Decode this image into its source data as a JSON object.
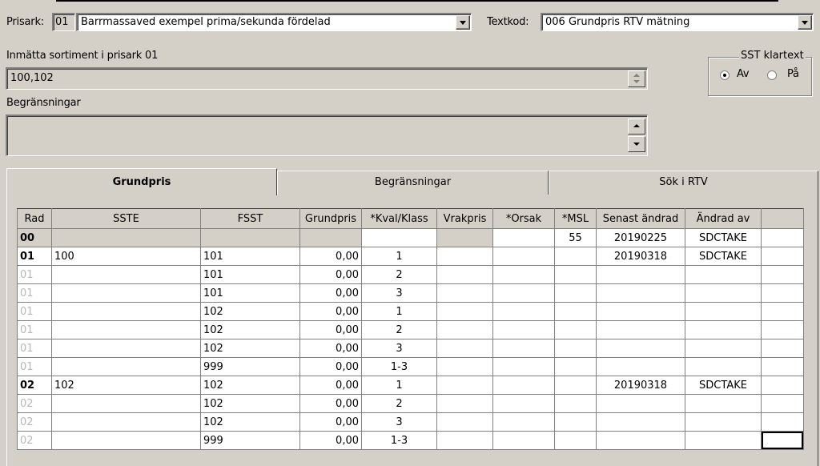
{
  "header": {
    "prisark_label": "Prisark:",
    "prisark_code": "01",
    "prisark_value": "Barrmassaved exempel prima/sekunda fördelad",
    "textkod_label": "Textkod:",
    "textkod_value": "006 Grundpris RTV mätning"
  },
  "sortiment": {
    "label": "Inmätta sortiment i prisark 01",
    "value": "100,102"
  },
  "restrictions": {
    "label": "Begränsningar",
    "value": ""
  },
  "sst_klartext": {
    "title": "SST klartext",
    "options": [
      {
        "label": "Av",
        "selected": true
      },
      {
        "label": "På",
        "selected": false
      }
    ]
  },
  "tabs": [
    {
      "label": "Grundpris",
      "active": true
    },
    {
      "label": "Begränsningar",
      "active": false
    },
    {
      "label": "Sök i RTV",
      "active": false
    }
  ],
  "grid": {
    "columns": [
      "Rad",
      "SSTE",
      "FSST",
      "Grundpris",
      "*Kval/Klass",
      "Vrakpris",
      "*Orsak",
      "*MSL",
      "Senast ändrad",
      "Ändrad av",
      ""
    ],
    "rows": [
      {
        "rad": "00",
        "sste": "",
        "fsst": "",
        "grundpris": "",
        "kval": "",
        "vrakpris": "",
        "orsak": "",
        "msl": "55",
        "senast": "20190225",
        "andrad_av": "SDCTAKE",
        "style": "header"
      },
      {
        "rad": "01",
        "sste": "100",
        "fsst": "101",
        "grundpris": "0,00",
        "kval": "1",
        "vrakpris": "",
        "orsak": "",
        "msl": "",
        "senast": "20190318",
        "andrad_av": "SDCTAKE",
        "style": "main"
      },
      {
        "rad": "01",
        "sste": "",
        "fsst": "101",
        "grundpris": "0,00",
        "kval": "2",
        "vrakpris": "",
        "orsak": "",
        "msl": "",
        "senast": "",
        "andrad_av": "",
        "style": "sub"
      },
      {
        "rad": "01",
        "sste": "",
        "fsst": "101",
        "grundpris": "0,00",
        "kval": "3",
        "vrakpris": "",
        "orsak": "",
        "msl": "",
        "senast": "",
        "andrad_av": "",
        "style": "sub"
      },
      {
        "rad": "01",
        "sste": "",
        "fsst": "102",
        "grundpris": "0,00",
        "kval": "1",
        "vrakpris": "",
        "orsak": "",
        "msl": "",
        "senast": "",
        "andrad_av": "",
        "style": "sub"
      },
      {
        "rad": "01",
        "sste": "",
        "fsst": "102",
        "grundpris": "0,00",
        "kval": "2",
        "vrakpris": "",
        "orsak": "",
        "msl": "",
        "senast": "",
        "andrad_av": "",
        "style": "sub"
      },
      {
        "rad": "01",
        "sste": "",
        "fsst": "102",
        "grundpris": "0,00",
        "kval": "3",
        "vrakpris": "",
        "orsak": "",
        "msl": "",
        "senast": "",
        "andrad_av": "",
        "style": "sub"
      },
      {
        "rad": "01",
        "sste": "",
        "fsst": "999",
        "grundpris": "0,00",
        "kval": "1-3",
        "vrakpris": "",
        "orsak": "",
        "msl": "",
        "senast": "",
        "andrad_av": "",
        "style": "sub"
      },
      {
        "rad": "02",
        "sste": "102",
        "fsst": "102",
        "grundpris": "0,00",
        "kval": "1",
        "vrakpris": "",
        "orsak": "",
        "msl": "",
        "senast": "20190318",
        "andrad_av": "SDCTAKE",
        "style": "main"
      },
      {
        "rad": "02",
        "sste": "",
        "fsst": "102",
        "grundpris": "0,00",
        "kval": "2",
        "vrakpris": "",
        "orsak": "",
        "msl": "",
        "senast": "",
        "andrad_av": "",
        "style": "sub"
      },
      {
        "rad": "02",
        "sste": "",
        "fsst": "102",
        "grundpris": "0,00",
        "kval": "3",
        "vrakpris": "",
        "orsak": "",
        "msl": "",
        "senast": "",
        "andrad_av": "",
        "style": "sub"
      },
      {
        "rad": "02",
        "sste": "",
        "fsst": "999",
        "grundpris": "0,00",
        "kval": "1-3",
        "vrakpris": "",
        "orsak": "",
        "msl": "",
        "senast": "",
        "andrad_av": "",
        "style": "sub"
      }
    ]
  }
}
